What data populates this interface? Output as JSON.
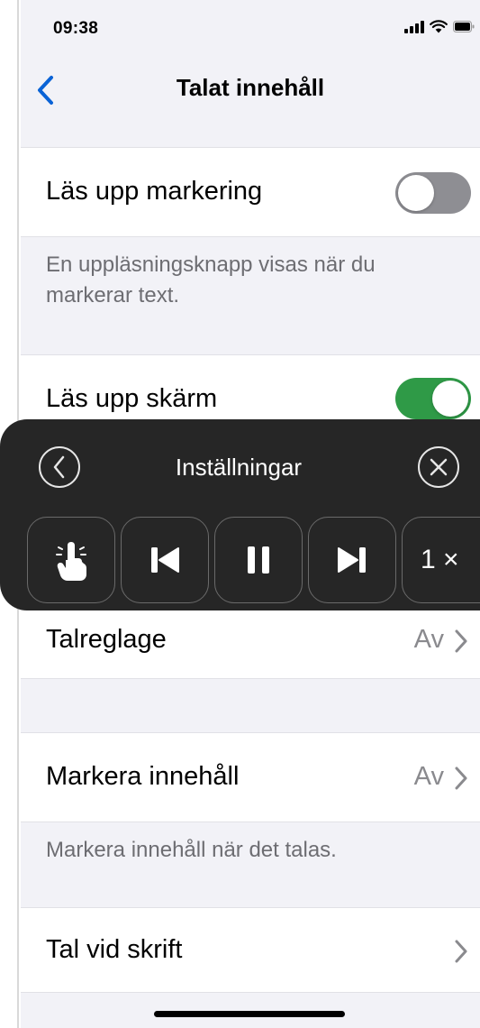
{
  "status_bar": {
    "time": "09:38",
    "icons": [
      "cellular-signal-icon",
      "wifi-icon",
      "battery-icon"
    ]
  },
  "nav": {
    "back_icon": "chevron-left-icon",
    "title": "Talat innehåll"
  },
  "sections": {
    "speak_selection": {
      "label": "Läs upp markering",
      "toggle_on": false,
      "footer": "En uppläsningsknapp visas när du markerar text."
    },
    "speak_screen": {
      "label": "Läs upp skärm",
      "toggle_on": true
    },
    "speech_controller_row": {
      "label": "Talreglage",
      "value": "Av"
    },
    "highlight_content": {
      "label": "Markera innehåll",
      "value": "Av",
      "footer": "Markera innehåll när det talas."
    },
    "typing_feedback": {
      "label": "Tal vid skrift"
    }
  },
  "speech_controller": {
    "title": "Inställningar",
    "back_icon": "chevron-left-circle-icon",
    "close_icon": "close-circle-icon",
    "buttons": [
      "touch-to-speak-icon",
      "skip-back-icon",
      "pause-icon",
      "skip-forward-icon"
    ],
    "speed": "1 ×"
  },
  "colors": {
    "background": "#f2f2f7",
    "accent_blue": "#0a63d6",
    "toggle_on": "#2f9a47",
    "toggle_off": "#8e8e93",
    "controller_bg": "#262626"
  }
}
